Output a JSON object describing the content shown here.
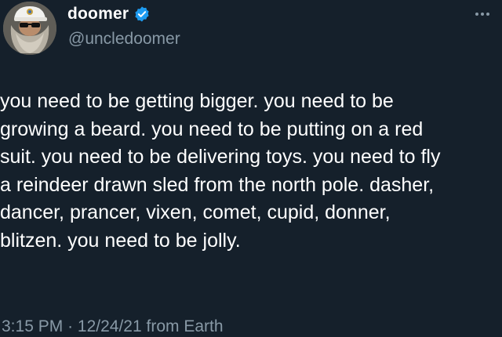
{
  "user": {
    "display_name": "doomer",
    "handle": "@uncledoomer",
    "verified": true,
    "verified_color": "#1d9bf0"
  },
  "tweet": {
    "lines": [
      "you need to be getting bigger. you need to be",
      "growing a beard. you need to be putting on a red",
      "suit. you need to be delivering toys. you need to fly",
      "a reindeer drawn sled from the north pole. dasher,",
      "dancer, prancer, vixen, comet, cupid, donner,",
      "blitzen. you need to be jolly."
    ],
    "time": "3:15 PM",
    "separator": "·",
    "date": "12/24/21",
    "source": "from Earth"
  },
  "icons": {
    "avatar": "avatar-image",
    "verified": "verified-badge-icon",
    "more": "more-options-icon"
  },
  "colors": {
    "background": "#15202b",
    "text": "#ffffff",
    "secondary_text": "#8899a6"
  }
}
